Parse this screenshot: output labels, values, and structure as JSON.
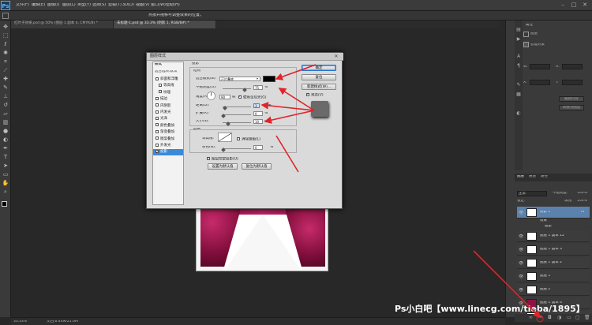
{
  "app": {
    "logo": "Ps"
  },
  "menubar": {
    "items": [
      "文件(F)",
      "编辑(E)",
      "图像(I)",
      "图层(L)",
      "类型(Y)",
      "选择(S)",
      "滤镜(T)",
      "3D(D)",
      "视图(V)",
      "窗口(W)",
      "帮助(H)"
    ],
    "window_buttons": [
      "–",
      "□",
      "✕"
    ]
  },
  "optionsbar": {
    "text": "点按并拖移可调整效果的位置。"
  },
  "doc_tabs": [
    {
      "label": "红叶子效果.psd @ 50% (图层 1 副本 4, CMYK/8) *",
      "active": false
    },
    {
      "label": "未标题-1.psd @ 33.3% (阴影 1, RGB/8#) *",
      "active": true
    }
  ],
  "toolbar": {
    "tools": [
      "move-icon",
      "marquee-icon",
      "lasso-icon",
      "quick-select-icon",
      "crop-icon",
      "eyedropper-icon",
      "healing-icon",
      "brush-icon",
      "stamp-icon",
      "history-brush-icon",
      "eraser-icon",
      "gradient-icon",
      "blur-icon",
      "dodge-icon",
      "pen-icon",
      "type-icon",
      "path-select-icon",
      "shape-icon",
      "hand-icon",
      "zoom-icon"
    ]
  },
  "dialog": {
    "title": "图层样式",
    "close": "✕",
    "styles_header": "样式",
    "blend_options": "混合选项:默认",
    "styles": [
      {
        "label": "斜面和浮雕",
        "checked": false,
        "indent": false
      },
      {
        "label": "等高线",
        "checked": false,
        "indent": true
      },
      {
        "label": "纹理",
        "checked": false,
        "indent": true
      },
      {
        "label": "描边",
        "checked": false,
        "indent": false
      },
      {
        "label": "内阴影",
        "checked": false,
        "indent": false
      },
      {
        "label": "内发光",
        "checked": false,
        "indent": false
      },
      {
        "label": "光泽",
        "checked": false,
        "indent": false
      },
      {
        "label": "颜色叠加",
        "checked": false,
        "indent": false
      },
      {
        "label": "渐变叠加",
        "checked": false,
        "indent": false
      },
      {
        "label": "图案叠加",
        "checked": false,
        "indent": false
      },
      {
        "label": "外发光",
        "checked": false,
        "indent": false
      },
      {
        "label": "投影",
        "checked": true,
        "indent": false,
        "selected": true
      }
    ],
    "section_title": "投影",
    "structure_label": "结构",
    "blend_mode_label": "混合模式(B):",
    "blend_mode_value": "正片叠底",
    "opacity_label": "不透明度(O):",
    "opacity_value": "75",
    "percent": "%",
    "angle_label": "角度(A):",
    "angle_value": "90",
    "degree": "度",
    "global_light_label": "使用全局光(G)",
    "distance_label": "距离(D):",
    "distance_value": "3",
    "unit_px": "像素",
    "spread_label": "扩展(R):",
    "spread_value": "0",
    "size_label": "大小(S):",
    "size_value": "10",
    "quality_label": "品质",
    "contour_label": "等高线:",
    "antialias_label": "消除锯齿(L)",
    "noise_label": "杂色(N):",
    "noise_value": "0",
    "knockout_label": "图层挖空投影(U)",
    "set_default": "设置为默认值",
    "reset_default": "复位为默认值",
    "ok": "确定",
    "cancel": "复位",
    "new_style": "新建样式(W)...",
    "preview": "预览(V)",
    "shadow_color": "#000000"
  },
  "right_panel": {
    "props_tab": "属性",
    "props_label": "图层",
    "smart_label": "智能对象",
    "w_label": "W:",
    "h_label": "H:",
    "x_label": "X:",
    "y_label": "Y:",
    "edit_label": "编辑内容",
    "convert_label": "转换为图层",
    "layers_tabs": [
      "图层",
      "通道",
      "路径"
    ],
    "blend_mode": "正常",
    "opacity_label": "不透明度:",
    "opacity_value": "100%",
    "lock_label": "锁定:",
    "fill_label": "填充:",
    "fill_value": "100%",
    "fx_label": "效果",
    "shadow_effect": "投影",
    "layers": [
      {
        "name": "阴影 1",
        "selected": true,
        "fx": true
      },
      {
        "name": "图层 1 副本 12",
        "selected": false,
        "fx": false
      },
      {
        "name": "图层 1 副本 3",
        "selected": false,
        "fx": false
      },
      {
        "name": "图层 1 副本 2",
        "selected": false,
        "fx": false
      },
      {
        "name": "图层 1",
        "selected": false,
        "fx": false
      },
      {
        "name": "图层 2",
        "selected": false,
        "fx": false
      },
      {
        "name": "图层 1 副本 4",
        "selected": false,
        "fx": false
      },
      {
        "name": "背景",
        "selected": false,
        "fx": false
      }
    ]
  },
  "statusbar": {
    "zoom": "33.33%",
    "doc": "文档:6.44M/21.6M"
  },
  "watermark": "Ps小白吧【www.linecg.com/tieba/1895】",
  "colors": {
    "accent_red": "#e0242a",
    "select_blue": "#3b8ad8"
  }
}
